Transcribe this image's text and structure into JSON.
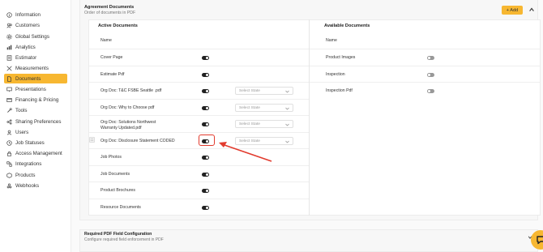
{
  "sidebar": {
    "items": [
      {
        "label": "Information",
        "icon": "info-icon"
      },
      {
        "label": "Customers",
        "icon": "customers-icon"
      },
      {
        "label": "Global Settings",
        "icon": "gear-icon"
      },
      {
        "label": "Analytics",
        "icon": "analytics-icon"
      },
      {
        "label": "Estimator",
        "icon": "estimator-icon"
      },
      {
        "label": "Measurements",
        "icon": "measurements-icon"
      },
      {
        "label": "Documents",
        "icon": "documents-icon",
        "active": true
      },
      {
        "label": "Presentations",
        "icon": "presentations-icon"
      },
      {
        "label": "Financing & Pricing",
        "icon": "financing-icon"
      },
      {
        "label": "Tools",
        "icon": "tools-icon"
      },
      {
        "label": "Sharing Preferences",
        "icon": "sharing-icon"
      },
      {
        "label": "Users",
        "icon": "users-icon"
      },
      {
        "label": "Job Statuses",
        "icon": "job-statuses-icon"
      },
      {
        "label": "Access Management",
        "icon": "access-icon"
      },
      {
        "label": "Integrations",
        "icon": "integrations-icon"
      },
      {
        "label": "Products",
        "icon": "products-icon"
      },
      {
        "label": "Webhooks",
        "icon": "webhooks-icon"
      }
    ]
  },
  "agreement": {
    "title": "Agreement Documents",
    "subtitle": "Order of documents in PDF",
    "add_label": "+ Add",
    "active_heading": "Active Documents",
    "available_heading": "Available Documents",
    "name_header": "Name",
    "select_placeholder": "Select State",
    "active_rows": [
      {
        "label": "Cover Page",
        "enabled": true,
        "select": false
      },
      {
        "label": "Estimate Pdf",
        "enabled": true,
        "select": false
      },
      {
        "label": "Org Doc: T&C FSBE Seattle .pdf",
        "enabled": true,
        "select": true
      },
      {
        "label": "Org Doc: Why to Choose                     pdf",
        "enabled": true,
        "select": true
      },
      {
        "label": "Org Doc:                     Solutions Northwest Warranty Updated.pdf",
        "enabled": true,
        "select": true
      },
      {
        "label": "Org Doc: Disclosure Statement CODED",
        "enabled": true,
        "select": true
      },
      {
        "label": "Job Photos",
        "enabled": true,
        "select": false
      },
      {
        "label": "Job Documents",
        "enabled": true,
        "select": false
      },
      {
        "label": "Product Brochures",
        "enabled": true,
        "select": false
      },
      {
        "label": "Resource Documents",
        "enabled": true,
        "select": false
      }
    ],
    "available_rows": [
      {
        "label": "Product Images",
        "enabled": false
      },
      {
        "label": "Inspection",
        "enabled": false
      },
      {
        "label": "Inspection Pdf",
        "enabled": false
      }
    ]
  },
  "required_pdf": {
    "title": "Required PDF Field Configuration",
    "subtitle": "Configure required field enforcement in PDF"
  },
  "colors": {
    "accent": "#f7b731",
    "annotation": "#e23b2e"
  }
}
